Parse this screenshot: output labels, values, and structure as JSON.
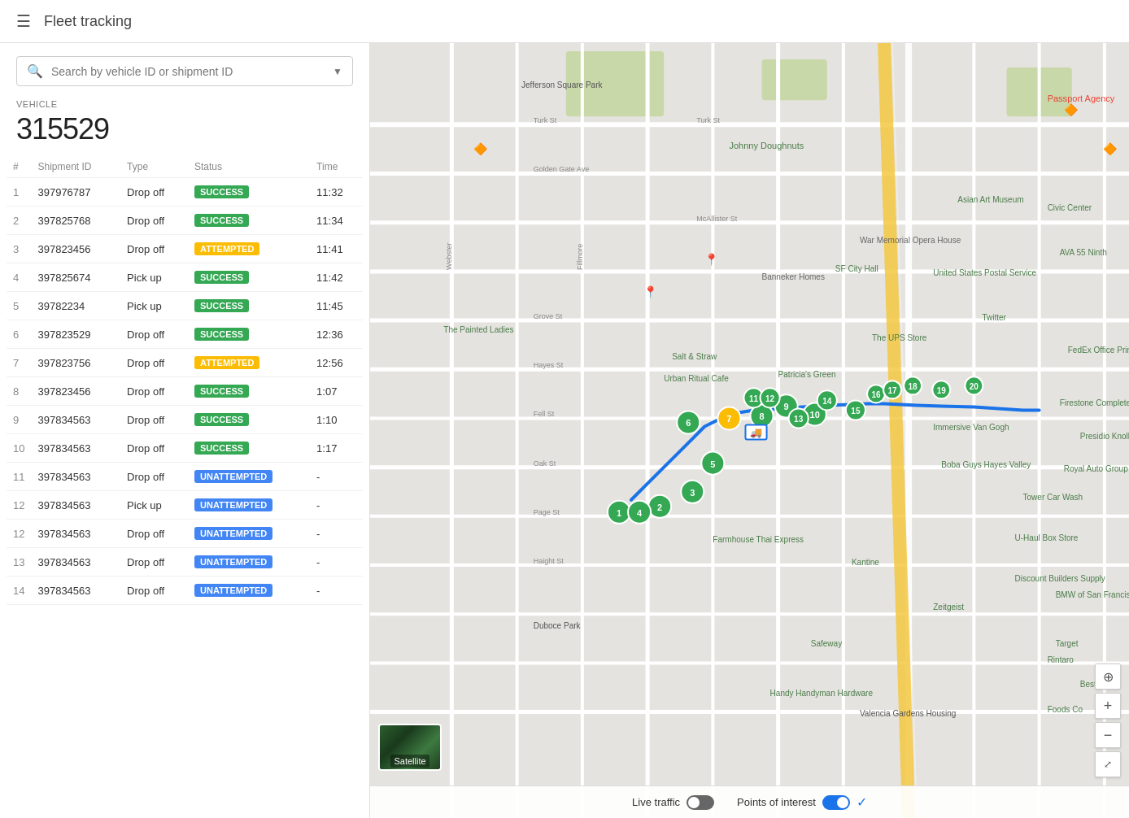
{
  "header": {
    "title": "Fleet tracking",
    "menu_icon": "☰"
  },
  "search": {
    "placeholder": "Search by vehicle ID or shipment ID"
  },
  "vehicle": {
    "label": "VEHICLE",
    "id": "315529"
  },
  "table": {
    "columns": [
      "#",
      "Shipment ID",
      "Type",
      "Status",
      "Time"
    ],
    "rows": [
      {
        "num": 1,
        "shipment_id": "397976787",
        "type": "Drop off",
        "status": "SUCCESS",
        "time": "11:32"
      },
      {
        "num": 2,
        "shipment_id": "397825768",
        "type": "Drop off",
        "status": "SUCCESS",
        "time": "11:34"
      },
      {
        "num": 3,
        "shipment_id": "397823456",
        "type": "Drop off",
        "status": "ATTEMPTED",
        "time": "11:41"
      },
      {
        "num": 4,
        "shipment_id": "397825674",
        "type": "Pick up",
        "status": "SUCCESS",
        "time": "11:42"
      },
      {
        "num": 5,
        "shipment_id": "39782234",
        "type": "Pick up",
        "status": "SUCCESS",
        "time": "11:45"
      },
      {
        "num": 6,
        "shipment_id": "397823529",
        "type": "Drop off",
        "status": "SUCCESS",
        "time": "12:36"
      },
      {
        "num": 7,
        "shipment_id": "397823756",
        "type": "Drop off",
        "status": "ATTEMPTED",
        "time": "12:56"
      },
      {
        "num": 8,
        "shipment_id": "397823456",
        "type": "Drop off",
        "status": "SUCCESS",
        "time": "1:07"
      },
      {
        "num": 9,
        "shipment_id": "397834563",
        "type": "Drop off",
        "status": "SUCCESS",
        "time": "1:10"
      },
      {
        "num": 10,
        "shipment_id": "397834563",
        "type": "Drop off",
        "status": "SUCCESS",
        "time": "1:17"
      },
      {
        "num": 11,
        "shipment_id": "397834563",
        "type": "Drop off",
        "status": "UNATTEMPTED",
        "time": "-"
      },
      {
        "num": 12,
        "shipment_id": "397834563",
        "type": "Pick up",
        "status": "UNATTEMPTED",
        "time": "-"
      },
      {
        "num": 12,
        "shipment_id": "397834563",
        "type": "Drop off",
        "status": "UNATTEMPTED",
        "time": "-"
      },
      {
        "num": 13,
        "shipment_id": "397834563",
        "type": "Drop off",
        "status": "UNATTEMPTED",
        "time": "-"
      },
      {
        "num": 14,
        "shipment_id": "397834563",
        "type": "Drop off",
        "status": "UNATTEMPTED",
        "time": "-"
      }
    ]
  },
  "map": {
    "live_traffic_label": "Live traffic",
    "points_of_interest_label": "Points of interest",
    "live_traffic_on": false,
    "points_of_interest_on": true,
    "satellite_label": "Satellite",
    "zoom_in": "+",
    "zoom_out": "−"
  }
}
